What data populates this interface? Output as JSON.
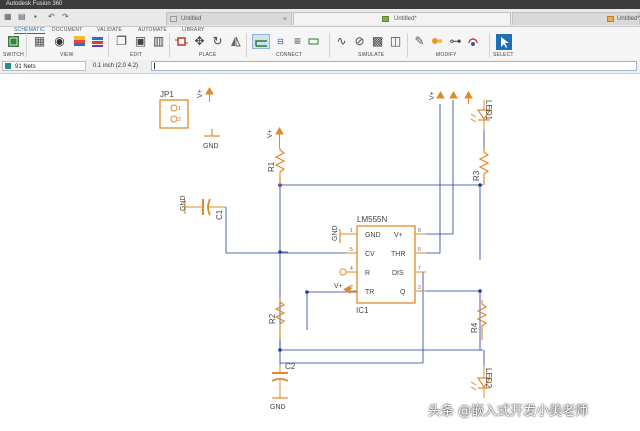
{
  "app": {
    "title": "Autodesk Fusion 360"
  },
  "tabs": [
    {
      "label": "Untitled"
    },
    {
      "label": "Untitled*"
    },
    {
      "label": "Untitled*"
    }
  ],
  "ribbon": {
    "tabs": [
      "SCHEMATIC",
      "DOCUMENT",
      "VALIDATE",
      "AUTOMATE",
      "LIBRARY"
    ],
    "groups": [
      "SWITCH",
      "VIEW",
      "EDIT",
      "PLACE",
      "CONNECT",
      "SIMULATE",
      "MODIFY",
      "SELECT"
    ]
  },
  "options": {
    "net_class": "91 Nets",
    "grid": "0.1 inch (2.0 4.2)",
    "command": ""
  },
  "schematic": {
    "jp1": {
      "name": "JP1",
      "pin1": "1",
      "pin2": "2"
    },
    "r1": "R1",
    "r2": "R2",
    "r3": "R3",
    "r4": "R4",
    "c1": "C1",
    "c2": "C2",
    "led1": "LED1",
    "led2": "LED2",
    "ic": {
      "part": "LM555N",
      "ref": "IC1",
      "pins_left": [
        "GND",
        "CV",
        "R",
        "TR"
      ],
      "pins_right": [
        "V+",
        "THR",
        "DIS",
        "Q"
      ],
      "pin_nums_left": [
        "1",
        "5",
        "4",
        "2"
      ],
      "pin_nums_right": [
        "8",
        "6",
        "7",
        "3"
      ]
    },
    "gnd_label": "GND",
    "vplus_label": "V+"
  },
  "colors": {
    "component": "#e08a2a",
    "wire": "#1f3aa0",
    "accent": "#1f6fb4"
  },
  "watermark": "头条 @嵌入式开发小美老师"
}
